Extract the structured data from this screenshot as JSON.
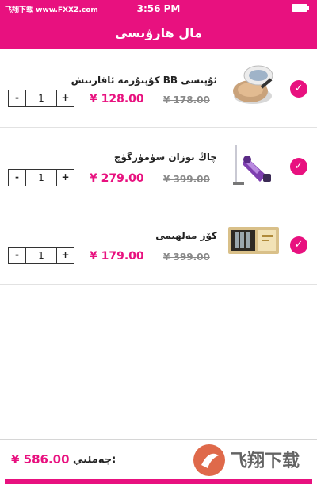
{
  "status_bar": {
    "time": "3:56 PM",
    "watermark": "飞翔下载 www.FXXZ.com"
  },
  "header": {
    "title": "مال ھارۋىسى"
  },
  "colors": {
    "accent": "#e8117f",
    "price_muted": "#8a8a8a",
    "divider": "#e2e2e2"
  },
  "cart": {
    "items": [
      {
        "title": "ئۇپىسى BB كۇپتۇرمە ئاقارتىش",
        "price": "¥ 128.00",
        "old_price": "¥ 178.00",
        "quantity": "1",
        "minus_label": "-",
        "plus_label": "+",
        "check_icon": "check-circle-icon",
        "image": "cushion-compact"
      },
      {
        "title": "چاڭ توزان سۈمۈرگۈچ",
        "price": "¥ 279.00",
        "old_price": "¥ 399.00",
        "quantity": "1",
        "minus_label": "-",
        "plus_label": "+",
        "check_icon": "check-circle-icon",
        "image": "vacuum-cleaner"
      },
      {
        "title": "كۆز مەلھىمى",
        "price": "¥ 179.00",
        "old_price": "¥ 399.00",
        "quantity": "1",
        "minus_label": "-",
        "plus_label": "+",
        "check_icon": "check-circle-icon",
        "image": "eye-cream-box"
      }
    ]
  },
  "footer": {
    "total_label": "جەمئىي:",
    "total_value": "¥ 586.00",
    "logo_text": "飞翔下载"
  }
}
